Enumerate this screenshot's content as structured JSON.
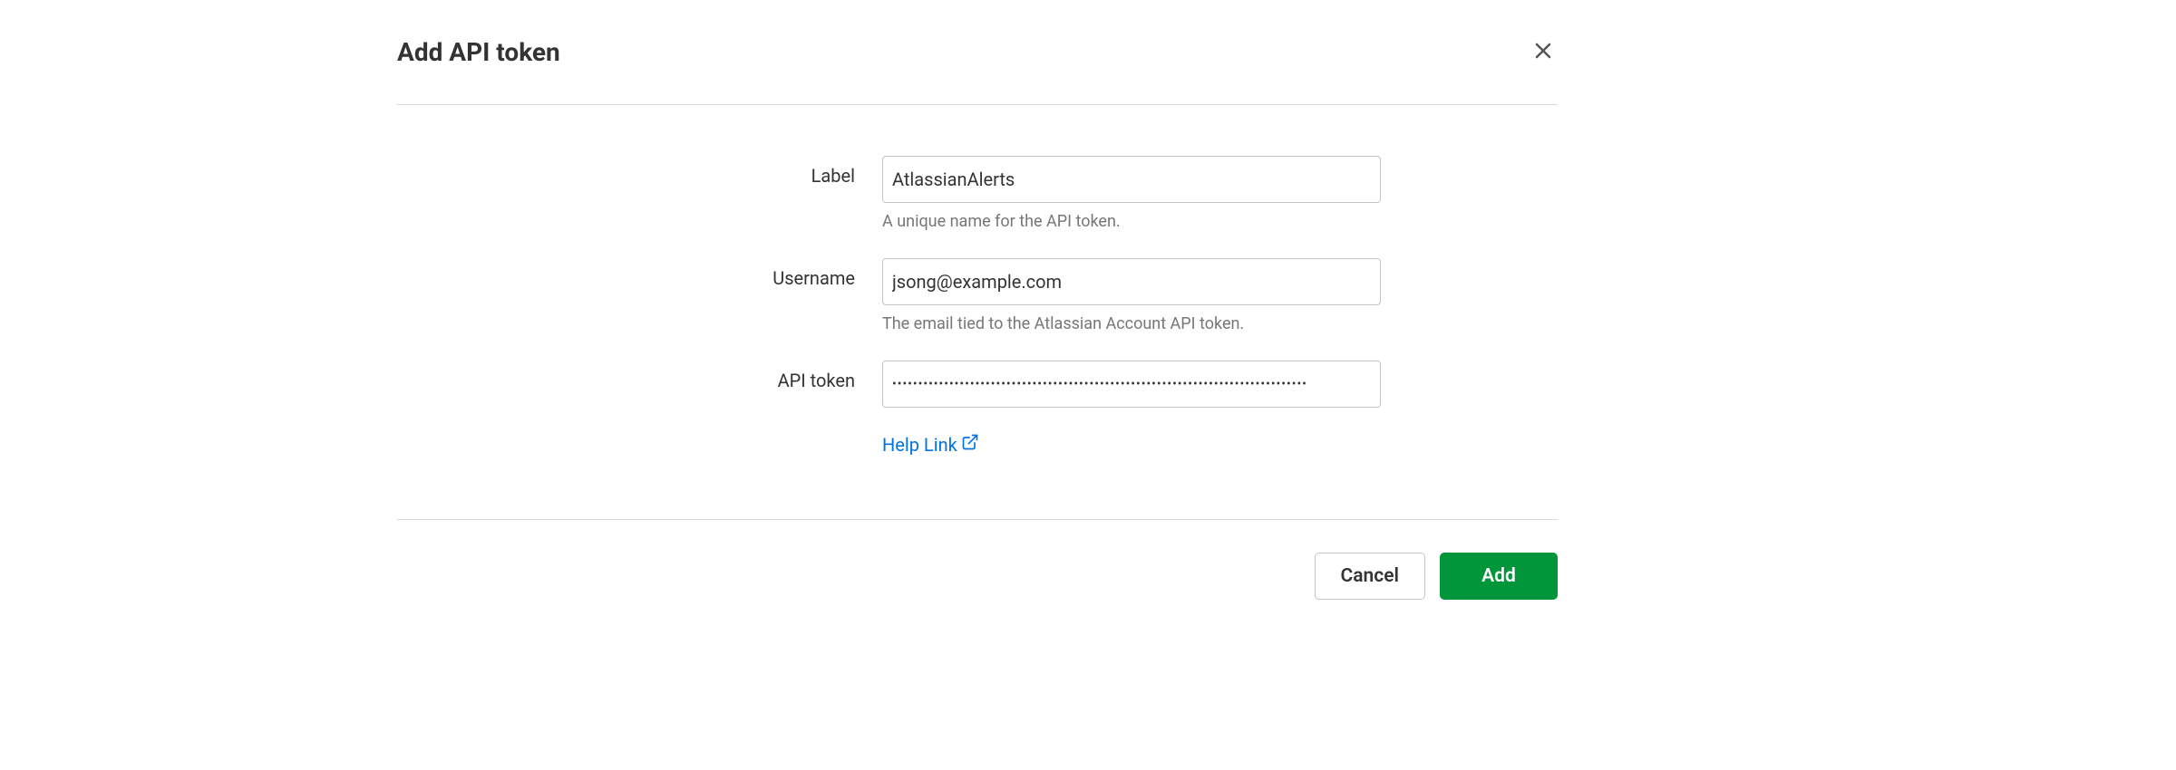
{
  "header": {
    "title": "Add API token"
  },
  "form": {
    "label": {
      "label": "Label",
      "value": "AtlassianAlerts",
      "hint": "A unique name for the API token."
    },
    "username": {
      "label": "Username",
      "value": "jsong@example.com",
      "hint": "The email tied to the Atlassian Account API token."
    },
    "apitoken": {
      "label": "API token",
      "value": "••••••••••••••••••••••••••••••••••••••••••••••••••••••••••••••••••••••••••••••••"
    },
    "help_link": "Help Link"
  },
  "footer": {
    "cancel": "Cancel",
    "add": "Add"
  }
}
